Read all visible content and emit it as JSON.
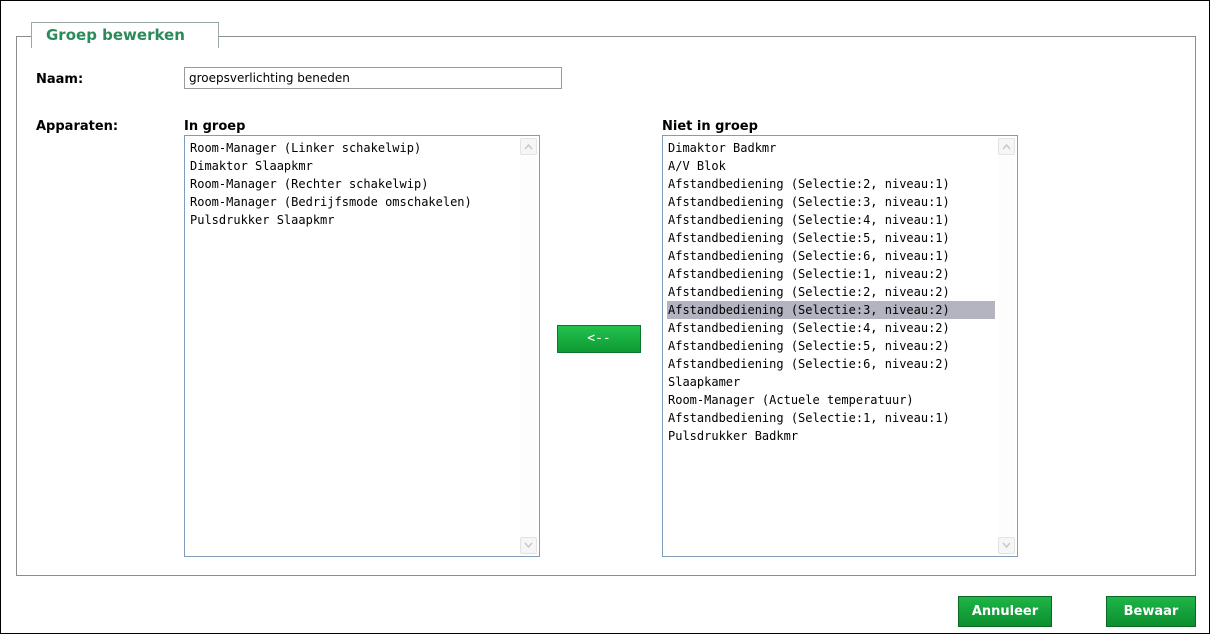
{
  "fieldset": {
    "legend": "Groep bewerken"
  },
  "name": {
    "label": "Naam:",
    "value": "groepsverlichting beneden"
  },
  "devices": {
    "label": "Apparaten:",
    "in_group": {
      "header": "In groep",
      "items": [
        "Room-Manager (Linker schakelwip)",
        "Dimaktor Slaapkmr",
        "Room-Manager (Rechter schakelwip)",
        "Room-Manager (Bedrijfsmode omschakelen)",
        "Pulsdrukker Slaapkmr"
      ]
    },
    "not_in_group": {
      "header": "Niet in groep",
      "selected_index": 9,
      "items": [
        "Dimaktor Badkmr",
        "A/V Blok",
        "Afstandbediening (Selectie:2, niveau:1)",
        "Afstandbediening (Selectie:3, niveau:1)",
        "Afstandbediening (Selectie:4, niveau:1)",
        "Afstandbediening (Selectie:5, niveau:1)",
        "Afstandbediening (Selectie:6, niveau:1)",
        "Afstandbediening (Selectie:1, niveau:2)",
        "Afstandbediening (Selectie:2, niveau:2)",
        "Afstandbediening (Selectie:3, niveau:2)",
        "Afstandbediening (Selectie:4, niveau:2)",
        "Afstandbediening (Selectie:5, niveau:2)",
        "Afstandbediening (Selectie:6, niveau:2)",
        "Slaapkamer",
        "Room-Manager (Actuele temperatuur)",
        "Afstandbediening (Selectie:1, niveau:1)",
        "Pulsdrukker Badkmr"
      ]
    },
    "move_button_label": "<--"
  },
  "buttons": {
    "cancel": "Annuleer",
    "save": "Bewaar"
  },
  "icons": {
    "scroll_up": "chevron-up-icon",
    "scroll_down": "chevron-down-icon"
  },
  "colors": {
    "legend_text": "#2a8a5a",
    "button_green": "#0d9a32",
    "selected_row": "#b4b4c0"
  }
}
